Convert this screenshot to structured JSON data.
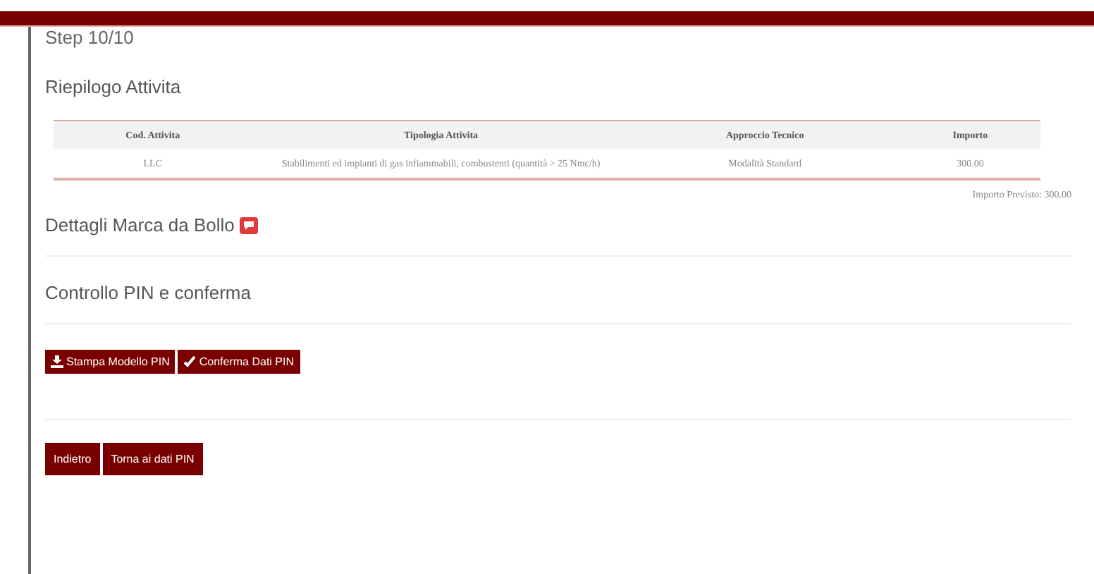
{
  "step": "Step 10/10",
  "summary": {
    "title": "Riepilogo Attivita",
    "columns": [
      "Cod. Attivita",
      "Tipologia Attivita",
      "Approccio Tecnico",
      "Importo"
    ],
    "rows": [
      [
        "LLC",
        "Stabilimenti ed impianti di gas infiammabili, combustenti (quantità > 25 Nmc/h)",
        "Modalità Standard",
        "300.00"
      ]
    ],
    "total": "Importo Previsto: 300.00"
  },
  "stamp": {
    "title": "Dettagli Marca da Bollo"
  },
  "pin": {
    "title": "Controllo PIN e conferma",
    "buttons": [
      {
        "kind": "download",
        "label": "Stampa Modello PIN"
      },
      {
        "kind": "check",
        "label": "Conferma Dati PIN"
      }
    ]
  },
  "nav_buttons": [
    "Indietro",
    "Torna ai dati PIN"
  ]
}
